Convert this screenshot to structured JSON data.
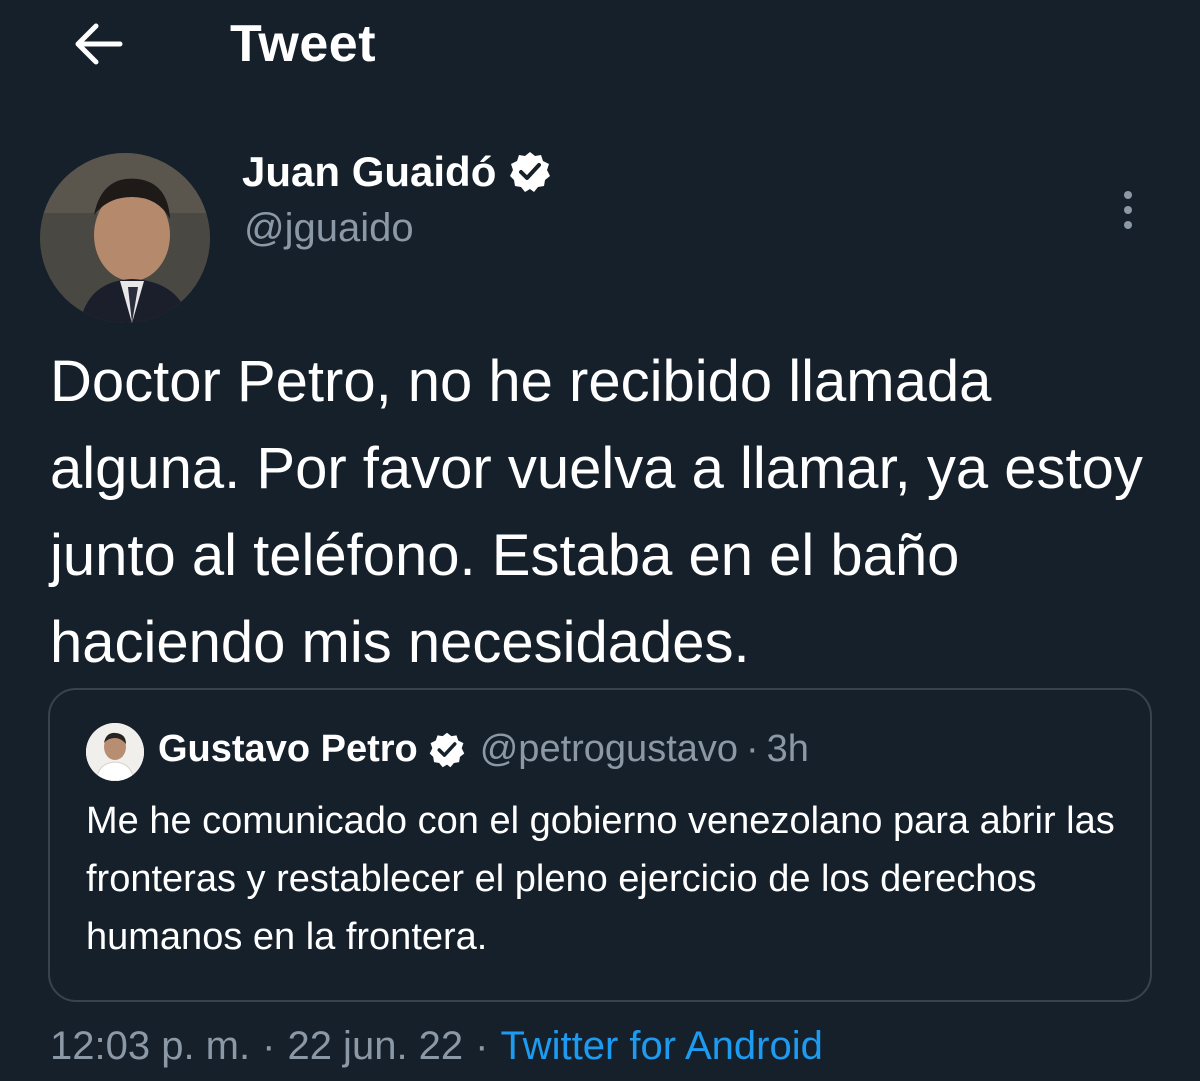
{
  "header": {
    "title": "Tweet",
    "back_icon": "arrow-left-icon"
  },
  "author": {
    "name": "Juan Guaidó",
    "handle": "@jguaido",
    "verified_icon": "verified-badge-icon"
  },
  "tweet": {
    "text": "Doctor Petro, no he recibido llamada alguna. Por favor vuelva a llamar, ya estoy junto al teléfono. Estaba en el baño haciendo mis necesidades."
  },
  "quoted_tweet": {
    "name": "Gustavo Petro",
    "handle": "@petrogustavo",
    "separator": "·",
    "time": "3h",
    "text": "Me he comunicado con el gobierno venezolano para abrir las fronteras y restablecer el pleno ejercicio de los derechos humanos en la frontera."
  },
  "meta": {
    "time": "12:03 p. m.",
    "separator": "·",
    "date": "22 jun. 22",
    "source": "Twitter for Android"
  },
  "colors": {
    "background": "#15202b",
    "secondary_text": "#8b98a5",
    "accent": "#1d9bf0",
    "border": "#38444d"
  }
}
